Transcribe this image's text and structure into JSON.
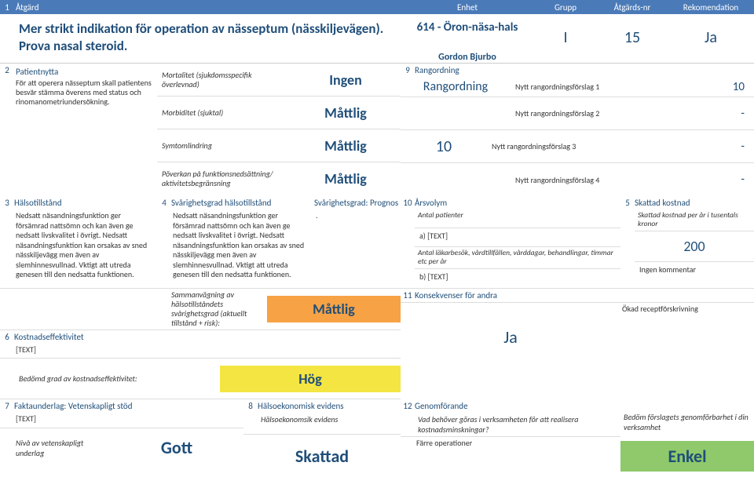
{
  "header": {
    "num": "1",
    "c1": "Åtgärd",
    "c2": "Enhet",
    "c3": "Grupp",
    "c4": "Åtgärds-nr",
    "c5": "Rekomendation"
  },
  "top": {
    "title": "Mer strikt indikation för operation av nässeptum (nässkiljevägen). Prova nasal steroid.",
    "unit": "614 - Öron-näsa-hals",
    "author": "Gordon Bjurbo",
    "group": "I",
    "actnum": "15",
    "rec": "Ja"
  },
  "s2": {
    "num": "2",
    "heading": "Patientnytta",
    "text": "För att operera nässeptum skall patientens besvär stämma överens med status och rinomanometriundersökning.",
    "metrics": [
      {
        "label": "Mortalitet (sjukdomsspecifik överlevnad)",
        "value": "Ingen"
      },
      {
        "label": "Morbiditet (sjuktal)",
        "value": "Måttlig"
      },
      {
        "label": "Symtomlindring",
        "value": "Måttlig"
      },
      {
        "label": "Pöverkan på funktionsnedsättning/ aktivitetsbegränsning",
        "value": "Måttlig"
      }
    ]
  },
  "s9": {
    "num": "9",
    "heading": "Rangordning",
    "word": "Rangordning",
    "big": "10",
    "rows": [
      {
        "label": "Nytt rangordningsförslag 1",
        "value": "10"
      },
      {
        "label": "Nytt rangordningsförslag 2",
        "value": "-"
      },
      {
        "label": "Nytt rangordningsförslag 3",
        "value": "-"
      },
      {
        "label": "Nytt rangordningsförslag 4",
        "value": "-"
      }
    ]
  },
  "s3": {
    "num": "3",
    "heading": "Hälsotillstånd",
    "text": "Nedsatt näsandningsfunktion ger försämrad nattsömn och kan även ge nedsatt livskvalitet i övrigt. Nedsatt näsandningsfunktion kan orsakas av sned nässkiljevägg men även av slemhinnesvullnad. Vktigt att utreda genesen till den nedsatta funktionen."
  },
  "s4": {
    "num": "4",
    "heading": "Svårighetsgrad hälsotillstånd",
    "text": "Nedsatt näsandningsfunktion ger försämrad nattsömn och kan även ge nedsatt livskvalitet i övrigt. Nedsatt näsandningsfunktion kan orsakas av sned nässkiljevägg men även av slemhinnesvullnad. Vktigt att utreda genesen till den nedsatta funktionen.",
    "sum_label": "Sammanvägning av hälsotillståndets svårighetsgrad (aktuellt tillstånd + risk):",
    "sum_value": "Måttlig"
  },
  "sPrognos": {
    "heading": "Svårighetsgrad: Prognos",
    "text": "."
  },
  "s10": {
    "num": "10",
    "heading": "Årsvolym",
    "r1": "Antal patienter",
    "r2": "a) [TEXT]",
    "r3": "Antal läkarbesök, vårdtillfällen, vårddagar, behandlingar, timmar etc per år",
    "r4": "b) [TEXT]"
  },
  "s5": {
    "num": "5",
    "heading": "Skattad kostnad",
    "r1": "Skattad kostnad per år i tusentals kronor",
    "value": "200",
    "r3": "Ingen kommentar"
  },
  "s6": {
    "num": "6",
    "heading": "Kostnadseffektivitet",
    "text": "[TEXT]",
    "label": "Bedömd grad av kostnadseffektivitet:",
    "value": "Hög"
  },
  "s11": {
    "num": "11",
    "heading": "Konsekvenser för andra",
    "value": "Ja",
    "right": "Ökad receptförskrivning"
  },
  "s7": {
    "num": "7",
    "heading": "Faktaunderlag: Vetenskapligt stöd",
    "text": "[TEXT]",
    "label": "Nivå av vetenskapligt underlag",
    "value": "Gott"
  },
  "s8": {
    "num": "8",
    "heading": "Hälsoekonomisk evidens",
    "label": "Hälsoekonomsik evidens",
    "value": "Skattad"
  },
  "s12": {
    "num": "12",
    "heading": "Genomförande",
    "q": "Vad behöver göras i verksamheten för att realisera kostnadsminskningar?",
    "a": "Färre operationer",
    "rlabel": "Bedöm förslagets genomförbarhet i din verksamhet",
    "value": "Enkel"
  }
}
